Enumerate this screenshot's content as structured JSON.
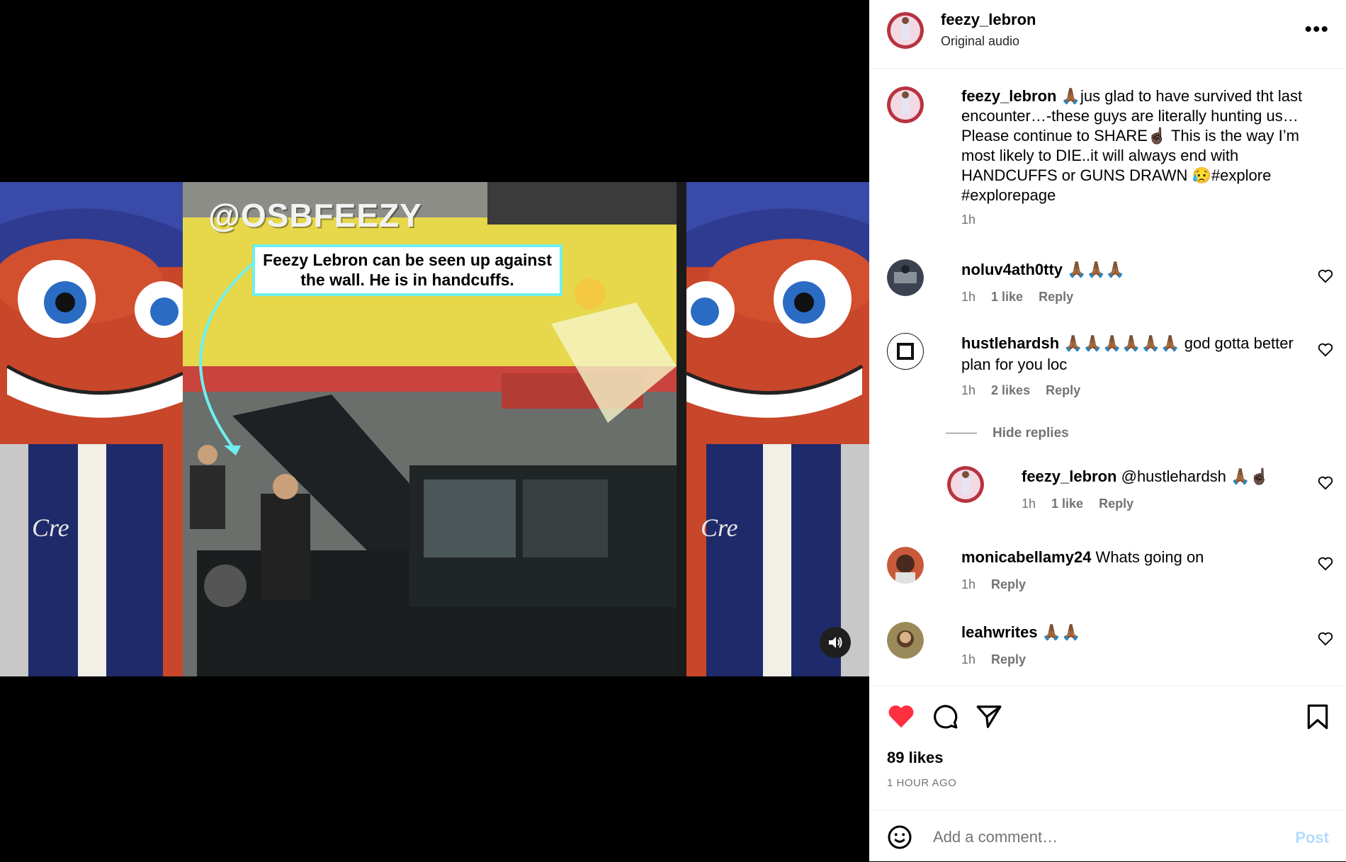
{
  "video": {
    "watermark": "@OSBFEEZY",
    "callout": "Feezy Lebron can be seen up against the wall. He is in handcuffs.",
    "mute_icon": "speaker-icon"
  },
  "header": {
    "username": "feezy_lebron",
    "audio": "Original audio",
    "more_icon": "more-options-icon"
  },
  "caption": {
    "username": "feezy_lebron",
    "text": " 🙏🏾jus glad to have survived tht last encounter…-these guys are literally hunting us… Please continue to SHARE☝🏿 This is the way I’m most likely to DIE..it will always end with HANDCUFFS or GUNS DRAWN 😥#explore #explorepage",
    "time": "1h"
  },
  "comments": [
    {
      "username": "noluv4ath0tty",
      "text": " 🙏🏾🙏🏾🙏🏾",
      "time": "1h",
      "likes": "1 like",
      "reply": "Reply"
    },
    {
      "username": "hustlehardsh",
      "text": " 🙏🏾🙏🏾🙏🏾🙏🏾🙏🏾🙏🏾 god gotta better plan for you loc",
      "time": "1h",
      "likes": "2 likes",
      "reply": "Reply"
    },
    {
      "username": "feezy_lebron",
      "text": " @hustlehardsh 🙏🏾☝🏿",
      "time": "1h",
      "likes": "1 like",
      "reply": "Reply"
    },
    {
      "username": "monicabellamy24",
      "text": " Whats going on",
      "time": "1h",
      "reply": "Reply"
    },
    {
      "username": "leahwrites",
      "text": " 🙏🏾🙏🏾",
      "time": "1h",
      "reply": "Reply"
    }
  ],
  "hide_replies": "Hide replies",
  "actions": {
    "likes": "89 likes",
    "time_ago": "1 HOUR AGO"
  },
  "composer": {
    "placeholder": "Add a comment…",
    "post": "Post"
  },
  "colors": {
    "like_red": "#ff3040",
    "post_blue": "#b3dbff",
    "callout_border": "#6ff0ee"
  }
}
